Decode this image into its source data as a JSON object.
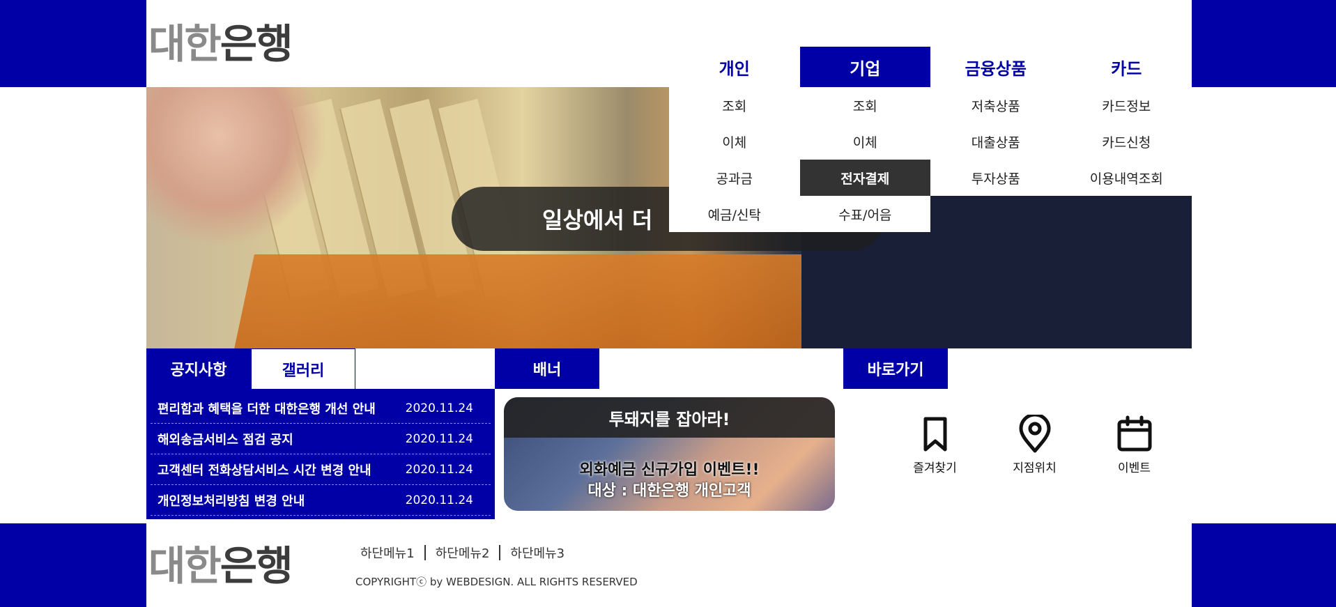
{
  "brand": {
    "logo_part1": "대한",
    "logo_part2": "은행"
  },
  "nav": {
    "menus": [
      {
        "label": "개인",
        "items": [
          "조회",
          "이체",
          "공과금",
          "예금/신탁"
        ]
      },
      {
        "label": "기업",
        "items": [
          "조회",
          "이체",
          "전자결제",
          "수표/어음"
        ]
      },
      {
        "label": "금융상품",
        "items": [
          "저축상품",
          "대출상품",
          "투자상품"
        ]
      },
      {
        "label": "카드",
        "items": [
          "카드정보",
          "카드신청",
          "이용내역조회"
        ]
      }
    ],
    "active_menu": "기업",
    "active_item": "전자결제"
  },
  "hero": {
    "caption": "일상에서 더 "
  },
  "notice": {
    "tab_notice": "공지사항",
    "tab_gallery": "갤러리",
    "rows": [
      {
        "title": "편리함과 혜택을 더한 대한은행 개선 안내",
        "date": "2020.11.24"
      },
      {
        "title": "해외송금서비스 점검 공지",
        "date": "2020.11.24"
      },
      {
        "title": "고객센터 전화상담서비스 시간 변경 안내",
        "date": "2020.11.24"
      },
      {
        "title": "개인정보처리방침 변경 안내",
        "date": "2020.11.24"
      }
    ]
  },
  "banner": {
    "heading": "배너",
    "title": "투돼지를 잡아라!",
    "line1": "외화예금 신규가입 이벤트!!",
    "line2": "대상 : 대한은행 개인고객"
  },
  "shortcuts": {
    "heading": "바로가기",
    "items": [
      {
        "label": "즐겨찾기",
        "icon": "bookmark-icon"
      },
      {
        "label": "지점위치",
        "icon": "location-pin-icon"
      },
      {
        "label": "이벤트",
        "icon": "calendar-icon"
      }
    ]
  },
  "footer": {
    "menu": [
      "하단메뉴1",
      "하단메뉴2",
      "하단메뉴3"
    ],
    "copyright": "COPYRIGHTⓒ by WEBDESIGN. ALL RIGHTS RESERVED"
  },
  "colors": {
    "primary": "#0000a6",
    "dark": "#333333",
    "white": "#ffffff"
  }
}
